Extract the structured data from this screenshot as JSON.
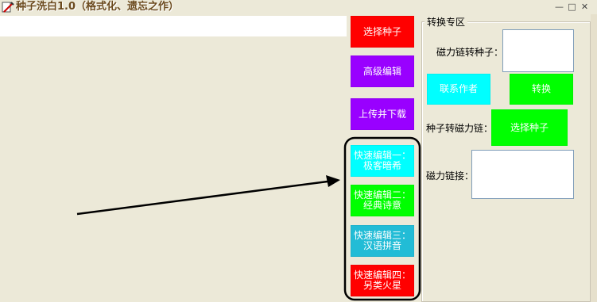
{
  "window": {
    "title": "种子洗白1.0（格式化、遗忘之作）",
    "minimize": "—",
    "maximize": "□",
    "close": "✕"
  },
  "left": {
    "input_value": ""
  },
  "buttons": {
    "select_seed": "选择种子",
    "advanced_edit": "高级编辑",
    "upload_download": "上传并下载",
    "quick1_line1": "快速编辑一：",
    "quick1_line2": "极客暗希",
    "quick2_line1": "快速编辑二：",
    "quick2_line2": "经典诗意",
    "quick3_line1": "快速编辑三：",
    "quick3_line2": "汉语拼音",
    "quick4_line1": "快速编辑四：",
    "quick4_line2": "另类火星"
  },
  "convert": {
    "group_title": "转换专区",
    "magnet_to_seed_label": "磁力链转种子：",
    "contact_author": "联系作者",
    "convert_button": "转换",
    "seed_to_magnet_label": "种子转磁力链：",
    "select_seed": "选择种子",
    "magnet_link_label": "磁力链接：",
    "magnet_input_value": "",
    "magnet_output_value": ""
  },
  "colors": {
    "red": "#ff0000",
    "purple": "#9900ff",
    "cyan": "#00ffff",
    "green": "#00ff00",
    "teal": "#22bcd6",
    "window_bg": "#ece9d8"
  }
}
